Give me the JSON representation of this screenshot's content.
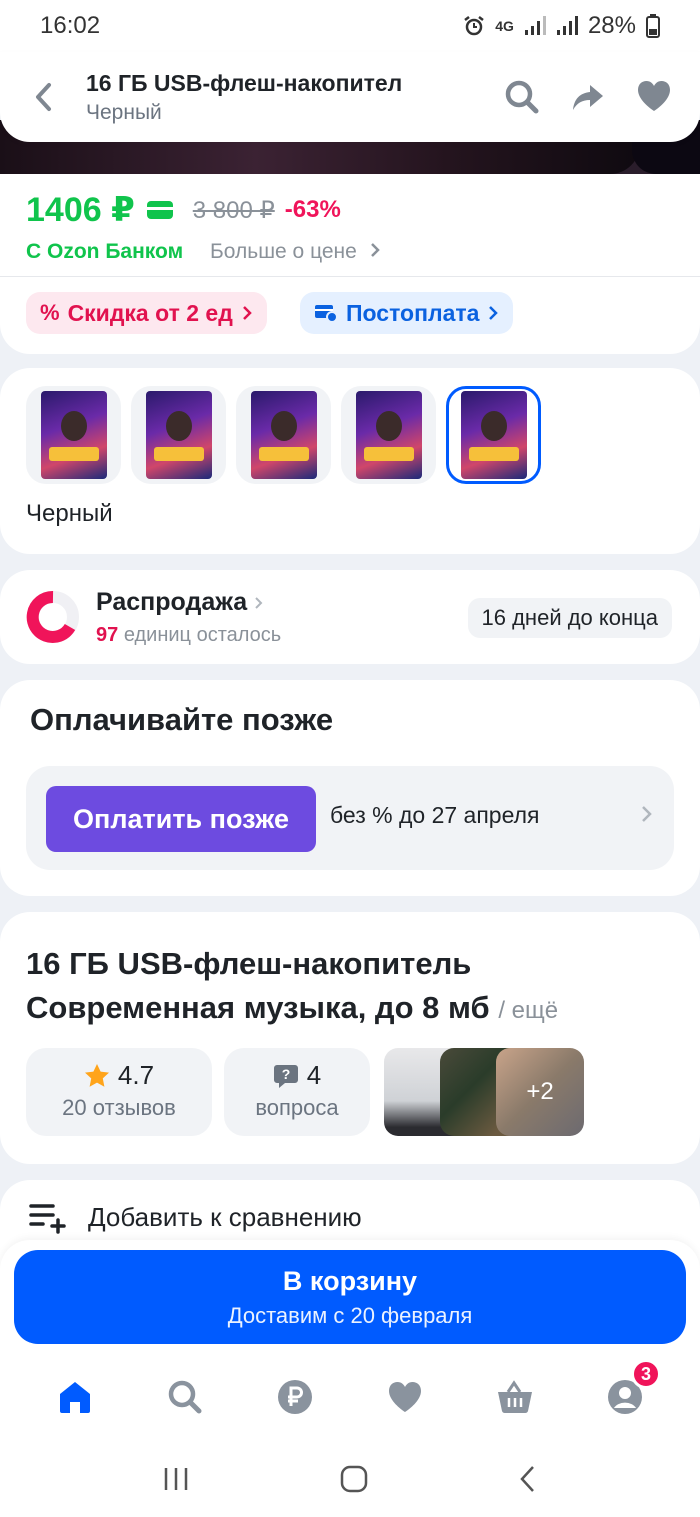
{
  "status_bar": {
    "time": "16:02",
    "network": "4G",
    "battery": "28%"
  },
  "header": {
    "title": "16 ГБ USB-флеш-накопител",
    "subtitle": "Черный"
  },
  "price": {
    "current": "1406 ₽",
    "old": "3 800 ₽",
    "discount": "-63%",
    "bank_label": "С Ozon Банком",
    "more_label": "Больше о цене"
  },
  "chips": {
    "discount": "Скидка от 2 ед",
    "postpay": "Постоплата"
  },
  "variants": {
    "thumbs": [
      "Флешка с русским рэпом",
      "Более 1400 треков электронной музыки",
      "1500+ треков рока + панк-рока",
      "Более 350 клипов для автомагнитолы",
      "1600+ треков 100+ часов музыки"
    ],
    "selected_label": "Черный"
  },
  "sale": {
    "title": "Распродажа",
    "count": "97",
    "units_left": "единиц осталось",
    "days_left": "16 дней до конца"
  },
  "pay_later": {
    "heading": "Оплачивайте позже",
    "button": "Оплатить позже",
    "terms": "без % до 27 апреля"
  },
  "product": {
    "title": "16 ГБ USB-флеш-накопитель Современная музыка, до 8 мб",
    "more": "/ ещё",
    "rating": "4.7",
    "reviews": "20 отзывов",
    "questions_count": "4",
    "questions_label": "вопроса",
    "photos_more": "+2"
  },
  "compare": {
    "label": "Добавить к сравнению"
  },
  "cart": {
    "label": "В корзину",
    "delivery": "Доставим с 20 февраля"
  },
  "tabbar": {
    "profile_badge": "3"
  },
  "colors": {
    "accent": "#005bff",
    "price_green": "#10c44c",
    "discount_pink": "#f0145a",
    "pay_later": "#6d4be0"
  }
}
